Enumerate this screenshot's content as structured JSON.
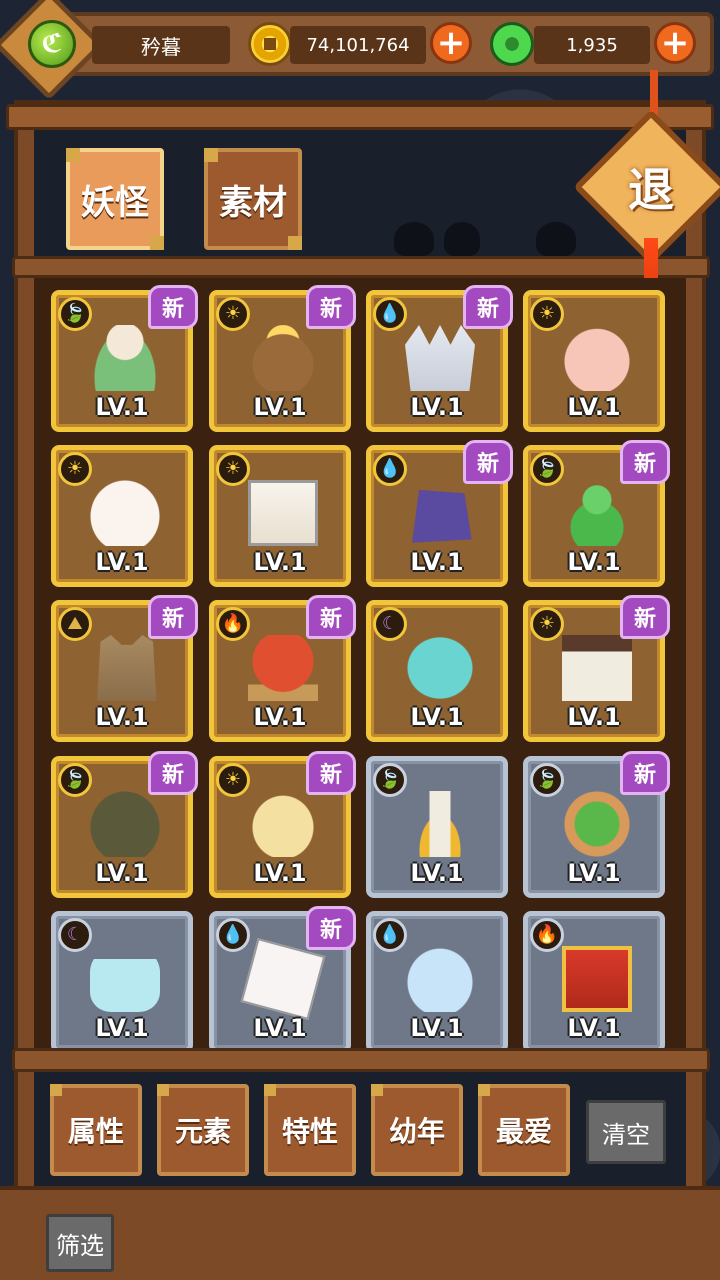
{
  "header": {
    "player_name": "矜暮",
    "gold_amount": "74,101,764",
    "jade_amount": "1,935"
  },
  "tabs": [
    {
      "label": "妖怪",
      "active": true
    },
    {
      "label": "素材",
      "active": false
    }
  ],
  "exit_label": "退",
  "level_label": "LV.1",
  "new_badge": "新",
  "cards": [
    {
      "element": "leaf",
      "new": true,
      "frame": "gold",
      "creature": "sprout-doll"
    },
    {
      "element": "sun",
      "new": true,
      "frame": "gold",
      "creature": "coconut"
    },
    {
      "element": "water",
      "new": true,
      "frame": "gold",
      "creature": "crown"
    },
    {
      "element": "sun",
      "new": false,
      "frame": "gold",
      "creature": "pink-blob"
    },
    {
      "element": "sun",
      "new": false,
      "frame": "gold",
      "creature": "white-bun"
    },
    {
      "element": "sun",
      "new": false,
      "frame": "gold",
      "creature": "mahjong-tile"
    },
    {
      "element": "water",
      "new": true,
      "frame": "gold",
      "creature": "purple-bag"
    },
    {
      "element": "leaf",
      "new": true,
      "frame": "gold",
      "creature": "green-gourd"
    },
    {
      "element": "earth",
      "new": true,
      "frame": "gold",
      "creature": "paper-bag-cat"
    },
    {
      "element": "fire",
      "new": true,
      "frame": "gold",
      "creature": "red-ball"
    },
    {
      "element": "moon",
      "new": false,
      "frame": "gold",
      "creature": "teal-egg"
    },
    {
      "element": "sun",
      "new": true,
      "frame": "gold",
      "creature": "coffee-cup"
    },
    {
      "element": "leaf",
      "new": true,
      "frame": "gold",
      "creature": "turtle"
    },
    {
      "element": "sun",
      "new": true,
      "frame": "gold",
      "creature": "chick"
    },
    {
      "element": "leaf",
      "new": false,
      "frame": "silver",
      "creature": "torch"
    },
    {
      "element": "leaf",
      "new": true,
      "frame": "silver",
      "creature": "dragon-tile"
    },
    {
      "element": "moon",
      "new": false,
      "frame": "silver",
      "creature": "bottle"
    },
    {
      "element": "water",
      "new": true,
      "frame": "silver",
      "creature": "card"
    },
    {
      "element": "water",
      "new": false,
      "frame": "silver",
      "creature": "cloud"
    },
    {
      "element": "fire",
      "new": false,
      "frame": "silver",
      "creature": "scroll"
    }
  ],
  "filters": {
    "buttons": [
      "属性",
      "元素",
      "特性",
      "幼年",
      "最爱"
    ],
    "clear": "清空"
  },
  "footer": {
    "filter_button": "筛选"
  },
  "colors": {
    "gold_frame": "#f2c63a",
    "silver_frame": "#b7c2d3",
    "new_badge": "#a44ac0",
    "wood": "#7c4a27"
  }
}
